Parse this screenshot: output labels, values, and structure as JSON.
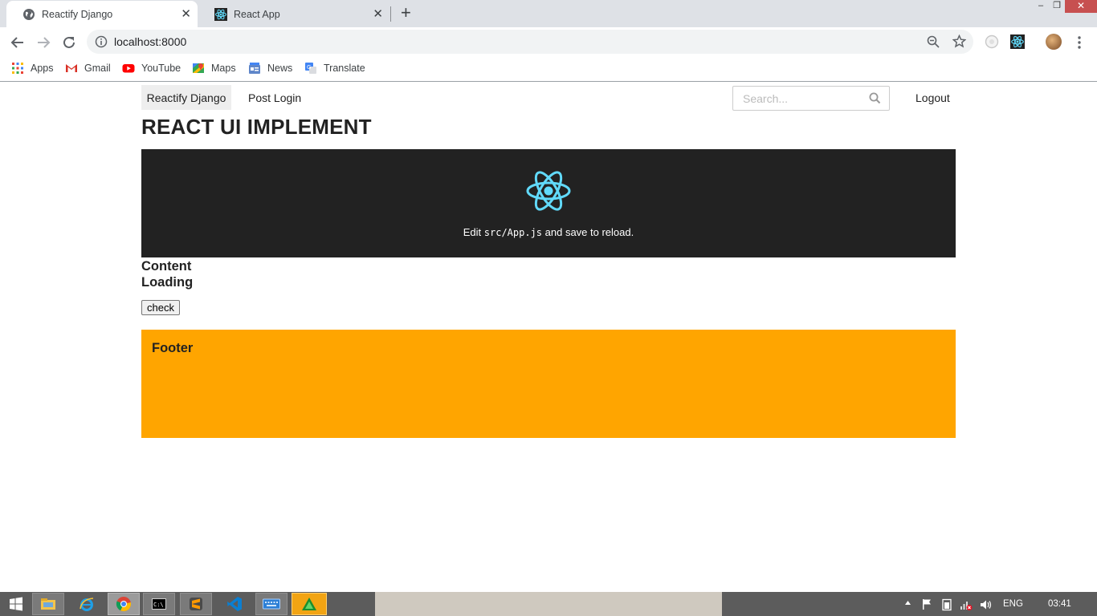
{
  "browser": {
    "tabs": [
      {
        "title": "Reactify Django",
        "active": true,
        "icon": "globe-icon"
      },
      {
        "title": "React App",
        "active": false,
        "icon": "react-icon"
      }
    ],
    "new_tab_label": "+",
    "close_label": "✕",
    "window_controls": {
      "minimize": "–",
      "restore": "❐",
      "close": "✕"
    },
    "url": "localhost:8000",
    "bookmarks": [
      {
        "label": "Apps",
        "icon": "apps-grid-icon"
      },
      {
        "label": "Gmail",
        "icon": "gmail-icon"
      },
      {
        "label": "YouTube",
        "icon": "youtube-icon"
      },
      {
        "label": "Maps",
        "icon": "maps-icon"
      },
      {
        "label": "News",
        "icon": "news-icon"
      },
      {
        "label": "Translate",
        "icon": "translate-icon"
      }
    ]
  },
  "page": {
    "nav": {
      "brand": "Reactify Django",
      "post_login": "Post Login",
      "search_placeholder": "Search...",
      "logout": "Logout"
    },
    "heading": "REACT UI IMPLEMENT",
    "app_header": {
      "edit_prefix": "Edit ",
      "edit_code": "src/App.js",
      "edit_suffix": " and save to reload."
    },
    "content_title": "Content",
    "loading_text": "Loading",
    "check_button": "check",
    "footer_title": "Footer"
  },
  "taskbar": {
    "language": "ENG",
    "time": "03:41",
    "apps": [
      "start-icon",
      "file-explorer-icon",
      "internet-explorer-icon",
      "chrome-icon",
      "cmd-icon",
      "sublime-icon",
      "vscode-icon",
      "keyboard-icon",
      "app-green-icon"
    ]
  },
  "colors": {
    "header_bg": "#222222",
    "react_blue": "#61dafb",
    "footer_bg": "#ffa500",
    "tab_strip": "#dee1e6",
    "taskbar": "#5c5c5c"
  }
}
